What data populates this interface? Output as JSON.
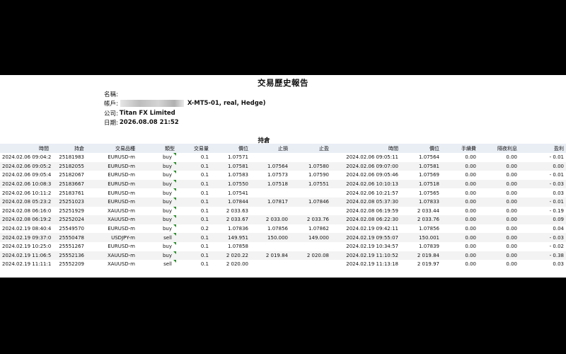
{
  "report": {
    "title": "交易歷史報告",
    "name_label": "名稱:",
    "account_label": "帳戶:",
    "account_suffix": "X-MT5-01, real, Hedge)",
    "company_label": "公司:",
    "company_value": "Titan FX Limited",
    "date_label": "日期:",
    "date_value": "2026.08.08 21:52",
    "section_title": "持倉"
  },
  "table": {
    "headers": [
      "時間",
      "持倉",
      "交易品種",
      "類型",
      "交易量",
      "價位",
      "止損",
      "止盈",
      "時間",
      "價位",
      "手續費",
      "隔夜利息",
      "盈利"
    ],
    "rows": [
      [
        "2024.02.06 09:04:29",
        "25181983",
        "EURUSD-m",
        "buy",
        "0.1",
        "1.07571",
        "",
        "",
        "2024.02.06 09:05:11",
        "1.07564",
        "0.00",
        "0.00",
        "- 0.01"
      ],
      [
        "2024.02.06 09:05:20",
        "25182055",
        "EURUSD-m",
        "buy",
        "0.1",
        "1.07581",
        "1.07564",
        "1.07580",
        "2024.02.06 09:07:00",
        "1.07581",
        "0.00",
        "0.00",
        "0.00"
      ],
      [
        "2024.02.06 09:05:46",
        "25182067",
        "EURUSD-m",
        "buy",
        "0.1",
        "1.07583",
        "1.07573",
        "1.07590",
        "2024.02.06 09:05:46",
        "1.07569",
        "0.00",
        "0.00",
        "- 0.01"
      ],
      [
        "2024.02.06 10:08:30",
        "25183667",
        "EURUSD-m",
        "buy",
        "0.1",
        "1.07550",
        "1.07518",
        "1.07551",
        "2024.02.06 10:10:13",
        "1.07518",
        "0.00",
        "0.00",
        "- 0.03"
      ],
      [
        "2024.02.06 10:11:22",
        "25183761",
        "EURUSD-m",
        "buy",
        "0.1",
        "1.07541",
        "",
        "",
        "2024.02.06 10:21:57",
        "1.07565",
        "0.00",
        "0.00",
        "0.03"
      ],
      [
        "2024.02.08 05:23:24",
        "25251023",
        "EURUSD-m",
        "buy",
        "0.1",
        "1.07844",
        "1.07817",
        "1.07846",
        "2024.02.08 05:37:30",
        "1.07833",
        "0.00",
        "0.00",
        "- 0.01"
      ],
      [
        "2024.02.08 06:16:06",
        "25251929",
        "XAUUSD-m",
        "buy",
        "0.1",
        "2 033.63",
        "",
        "",
        "2024.02.08 06:19:59",
        "2 033.44",
        "0.00",
        "0.00",
        "- 0.19"
      ],
      [
        "2024.02.08 06:19:29",
        "25252024",
        "XAUUSD-m",
        "buy",
        "0.1",
        "2 033.67",
        "2 033.00",
        "2 033.76",
        "2024.02.08 06:22:30",
        "2 033.76",
        "0.00",
        "0.00",
        "0.09"
      ],
      [
        "2024.02.19 08:40:40",
        "25549570",
        "EURUSD-m",
        "buy",
        "0.2",
        "1.07836",
        "1.07856",
        "1.07862",
        "2024.02.19 09:42:11",
        "1.07856",
        "0.00",
        "0.00",
        "0.04"
      ],
      [
        "2024.02.19 09:37:06",
        "25550478",
        "USDJPY-m",
        "sell",
        "0.1",
        "149.951",
        "150.000",
        "149.000",
        "2024.02.19 09:55:07",
        "150.001",
        "0.00",
        "0.00",
        "- 0.03"
      ],
      [
        "2024.02.19 10:25:06",
        "25551267",
        "EURUSD-m",
        "buy",
        "0.1",
        "1.07858",
        "",
        "",
        "2024.02.19 10:34:57",
        "1.07839",
        "0.00",
        "0.00",
        "- 0.02"
      ],
      [
        "2024.02.19 11:06:56",
        "25552136",
        "XAUUSD-m",
        "buy",
        "0.1",
        "2 020.22",
        "2 019.84",
        "2 020.08",
        "2024.02.19 11:10:52",
        "2 019.84",
        "0.00",
        "0.00",
        "- 0.38"
      ],
      [
        "2024.02.19 11:11:19",
        "25552209",
        "XAUUSD-m",
        "sell",
        "0.1",
        "2 020.00",
        "",
        "",
        "2024.02.19 11:13:18",
        "2 019.97",
        "0.00",
        "0.00",
        "0.03"
      ]
    ]
  },
  "colors": {
    "header_bg": "#e9eef5",
    "flag": "#2e8b2e"
  }
}
